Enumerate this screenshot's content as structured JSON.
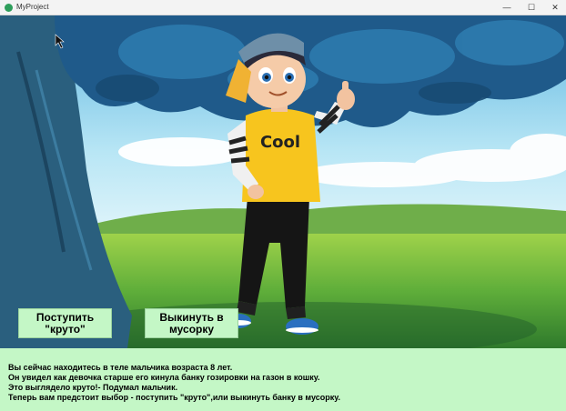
{
  "window": {
    "title": "MyProject",
    "minimize_glyph": "—",
    "maximize_glyph": "☐",
    "close_glyph": "✕"
  },
  "scene": {
    "shirt_text": "Cool"
  },
  "buttons": {
    "option1": "Поступить\n\"круто\"",
    "option2": "Выкинуть в\nмусорку"
  },
  "story": {
    "lines": [
      "Вы сейчас находитесь в теле мальчика возраста 8 лет.",
      "Он увидел как девочка старше его кинула банку гозировки на газон в кошку.",
      "Это выглядело круто!- Подумал мальчик.",
      "Теперь вам предстоит выбор - поступить \"круто\",или выкинуть банку в мусорку."
    ]
  },
  "colors": {
    "panel": "#c4f7c6",
    "sky": "#8fd4f0",
    "foliage": "#1f5a8a",
    "shirt": "#f7c51e",
    "pants": "#151515"
  }
}
